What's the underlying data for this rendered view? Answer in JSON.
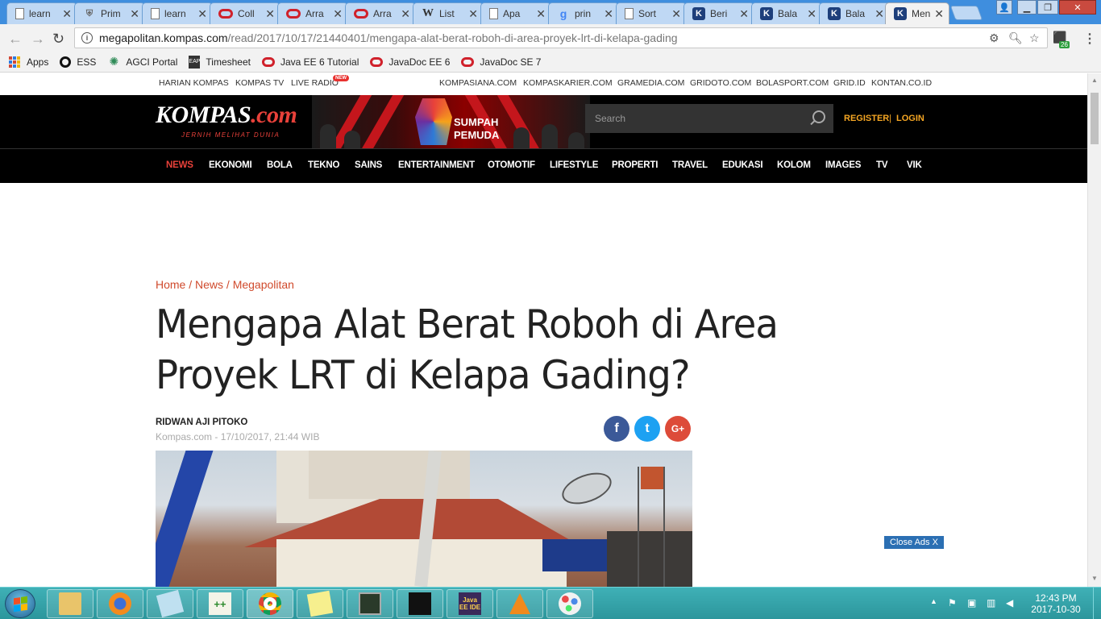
{
  "browser": {
    "tabs": [
      {
        "title": "learn",
        "icon": "document-icon"
      },
      {
        "title": "Prim",
        "icon": "shield-icon"
      },
      {
        "title": "learn",
        "icon": "document-icon"
      },
      {
        "title": "Coll",
        "icon": "oracle-icon"
      },
      {
        "title": "Arra",
        "icon": "oracle-icon"
      },
      {
        "title": "Arra",
        "icon": "oracle-icon"
      },
      {
        "title": "List",
        "icon": "wikipedia-icon"
      },
      {
        "title": "Apa",
        "icon": "document-icon"
      },
      {
        "title": "prin",
        "icon": "google-icon"
      },
      {
        "title": "Sort",
        "icon": "document-icon"
      },
      {
        "title": "Beri",
        "icon": "kompas-icon"
      },
      {
        "title": "Bala",
        "icon": "kompas-icon"
      },
      {
        "title": "Bala",
        "icon": "kompas-icon"
      },
      {
        "title": "Men",
        "icon": "kompas-icon"
      }
    ],
    "url_host": "megapolitan.kompas.com",
    "url_path": "/read/2017/10/17/21440401/mengapa-alat-berat-roboh-di-area-proyek-lrt-di-kelapa-gading",
    "extension_badge": "26",
    "bookmarks": [
      {
        "label": "Apps",
        "icon": "apps-grid-icon"
      },
      {
        "label": "ESS",
        "icon": "ess-icon"
      },
      {
        "label": "AGCI Portal",
        "icon": "agci-icon"
      },
      {
        "label": "Timesheet",
        "icon": "timesheet-icon"
      },
      {
        "label": "Java EE 6 Tutorial",
        "icon": "oracle-icon"
      },
      {
        "label": "JavaDoc EE 6",
        "icon": "oracle-icon"
      },
      {
        "label": "JavaDoc SE 7",
        "icon": "oracle-icon"
      }
    ]
  },
  "site": {
    "topnav_left": [
      "HARIAN KOMPAS",
      "KOMPAS TV",
      "LIVE RADIO"
    ],
    "live_badge": "NEW",
    "topnav_right": [
      "KOMPASIANA.COM",
      "KOMPASKARIER.COM",
      "GRAMEDIA.COM",
      "GRIDOTO.COM",
      "BOLASPORT.COM",
      "GRID.ID",
      "KONTAN.CO.ID"
    ],
    "logo_main": "KOMPAS",
    "logo_suffix": ".com",
    "tagline": "JERNIH MELIHAT DUNIA",
    "banner_line1": "SUMPAH",
    "banner_line2": "PEMUDA",
    "search_placeholder": "Search",
    "register": "REGISTER",
    "auth_sep": "|",
    "login": "LOGIN",
    "nav": [
      "NEWS",
      "EKONOMI",
      "BOLA",
      "TEKNO",
      "SAINS",
      "ENTERTAINMENT",
      "OTOMOTIF",
      "LIFESTYLE",
      "PROPERTI",
      "TRAVEL",
      "EDUKASI",
      "KOLOM",
      "IMAGES",
      "TV",
      "VIK"
    ],
    "active_nav": "NEWS",
    "accent": "#e8413a"
  },
  "article": {
    "breadcrumb": "Home / News / Megapolitan",
    "title": "Mengapa Alat Berat Roboh di Area Proyek LRT di Kelapa Gading?",
    "author": "RIDWAN AJI PITOKO",
    "dateline": "Kompas.com - 17/10/2017, 21:44 WIB",
    "share": {
      "facebook": "f",
      "twitter": "t",
      "google": "G+"
    },
    "close_ads": "Close Ads X"
  },
  "taskbar": {
    "apps": [
      "file-explorer-icon",
      "firefox-icon",
      "notepad-icon",
      "notepad-plus-icon",
      "chrome-icon",
      "sticky-notes-icon",
      "task-manager-icon",
      "terminal-icon",
      "java-ee-ide-icon",
      "vlc-icon",
      "paint-icon"
    ],
    "java_label": "Java EE IDE",
    "time": "12:43 PM",
    "date": "2017-10-30"
  }
}
